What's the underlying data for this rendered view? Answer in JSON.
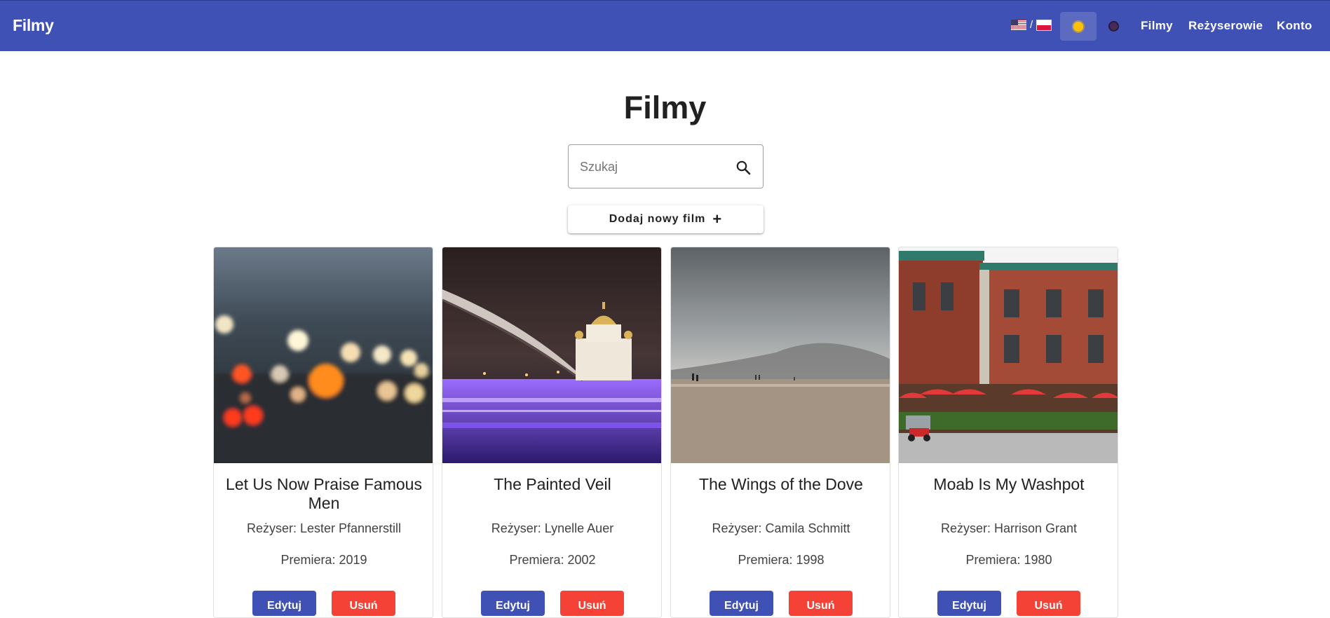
{
  "nav": {
    "brand": "Filmy",
    "lang_separator": "/",
    "links": [
      "Filmy",
      "Reżyserowie",
      "Konto"
    ]
  },
  "main": {
    "title": "Filmy",
    "search_placeholder": "Szukaj",
    "add_button": "Dodaj nowy film",
    "edit_label": "Edytuj",
    "delete_label": "Usuń"
  },
  "movies": [
    {
      "title": "Let Us Now Praise Famous Men",
      "director": "Reżyser: Lester Pfannerstill",
      "premiere": "Premiera: 2019"
    },
    {
      "title": "The Painted Veil",
      "director": "Reżyser: Lynelle Auer",
      "premiere": "Premiera: 2002"
    },
    {
      "title": "The Wings of the Dove",
      "director": "Reżyser: Camila Schmitt",
      "premiere": "Premiera: 1998"
    },
    {
      "title": "Moab Is My Washpot",
      "director": "Reżyser: Harrison Grant",
      "premiere": "Premiera: 1980"
    }
  ],
  "colors": {
    "primary": "#3f51b5",
    "danger": "#f44336",
    "sun": "#ffc107"
  }
}
